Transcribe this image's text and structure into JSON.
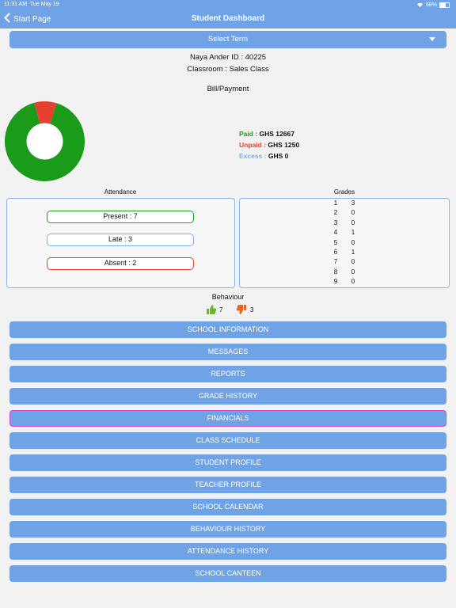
{
  "status_bar": {
    "time": "11:31 AM",
    "date": "Tue May 19",
    "battery": "68%"
  },
  "nav": {
    "back_label": "Start Page",
    "title": "Student Dashboard"
  },
  "term_select": {
    "label": "Select Term"
  },
  "student": {
    "id_line": "Naya Ander ID : 40225",
    "classroom_line": "Classroom : Sales Class"
  },
  "bill": {
    "title": "Bill/Payment",
    "paid_label": "Paid :",
    "paid_value": "GHS 12667",
    "unpaid_label": "Unpaid :",
    "unpaid_value": "GHS 1250",
    "excess_label": "Excess :",
    "excess_value": "GHS 0",
    "colors": {
      "paid": "#1a9c1a",
      "unpaid": "#e5412e",
      "excess": "#7aaee8"
    }
  },
  "chart_data": {
    "type": "pie",
    "categories": [
      "Paid",
      "Unpaid",
      "Excess"
    ],
    "values": [
      12667,
      1250,
      0
    ],
    "colors": [
      "#1a9c1a",
      "#e5412e",
      "#7aaee8"
    ],
    "title": "",
    "donut": true
  },
  "attendance": {
    "title": "Attendance",
    "present": "Present : 7",
    "late": "Late : 3",
    "absent": "Absent : 2"
  },
  "grades": {
    "title": "Grades",
    "rows": [
      {
        "grade": "1",
        "count": "3"
      },
      {
        "grade": "2",
        "count": "0"
      },
      {
        "grade": "3",
        "count": "0"
      },
      {
        "grade": "4",
        "count": "1"
      },
      {
        "grade": "5",
        "count": "0"
      },
      {
        "grade": "6",
        "count": "1"
      },
      {
        "grade": "7",
        "count": "0"
      },
      {
        "grade": "8",
        "count": "0"
      },
      {
        "grade": "9",
        "count": "0"
      }
    ]
  },
  "behaviour": {
    "title": "Behaviour",
    "positive": "7",
    "negative": "3",
    "positive_icon": "thumbs-up-icon",
    "negative_icon": "thumbs-down-icon"
  },
  "menu": [
    {
      "label": "SCHOOL INFORMATION"
    },
    {
      "label": "MESSAGES"
    },
    {
      "label": "REPORTS"
    },
    {
      "label": "GRADE HISTORY"
    },
    {
      "label": "FINANCIALS"
    },
    {
      "label": "CLASS SCHEDULE"
    },
    {
      "label": "STUDENT PROFILE"
    },
    {
      "label": "TEACHER PROFILE"
    },
    {
      "label": "SCHOOL CALENDAR"
    },
    {
      "label": "BEHAVIOUR HISTORY"
    },
    {
      "label": "ATTENDANCE HISTORY"
    },
    {
      "label": "SCHOOL CANTEEN"
    }
  ]
}
